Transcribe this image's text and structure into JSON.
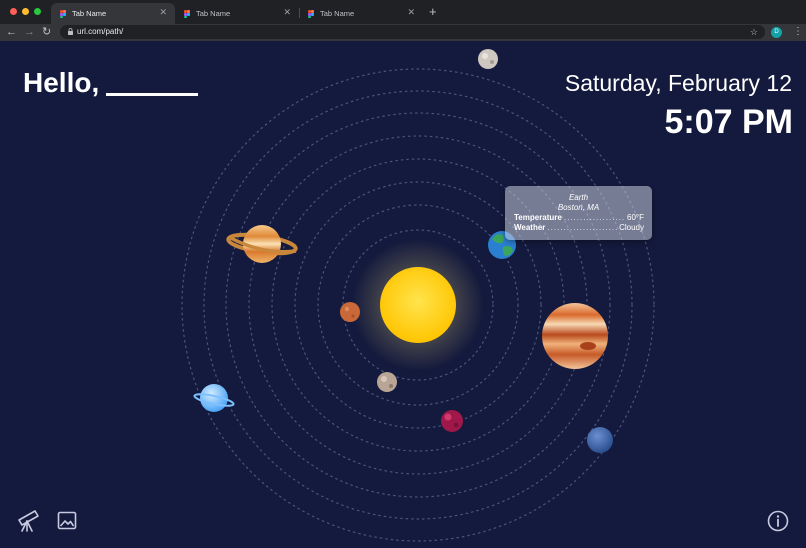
{
  "browser": {
    "tabs": [
      {
        "label": "Tab Name",
        "active": true
      },
      {
        "label": "Tab Name",
        "active": false
      },
      {
        "label": "Tab Name",
        "active": false
      }
    ],
    "url": "url.com/path/",
    "profile_initial": "D"
  },
  "page": {
    "greeting": "Hello,",
    "date": "Saturday, February 12",
    "time": "5:07 PM"
  },
  "tooltip": {
    "planet": "Earth",
    "location": "Boston, MA",
    "rows": [
      {
        "key": "Temperature",
        "value": "60°F"
      },
      {
        "key": "Weather",
        "value": "Cloudy"
      }
    ]
  },
  "colors": {
    "background": "#141a3d",
    "sun": "#ffcc1a",
    "orbit": "#5a6390"
  },
  "icons": {
    "bottom_left": [
      "telescope-icon",
      "image-icon"
    ],
    "bottom_right": [
      "info-icon"
    ]
  }
}
